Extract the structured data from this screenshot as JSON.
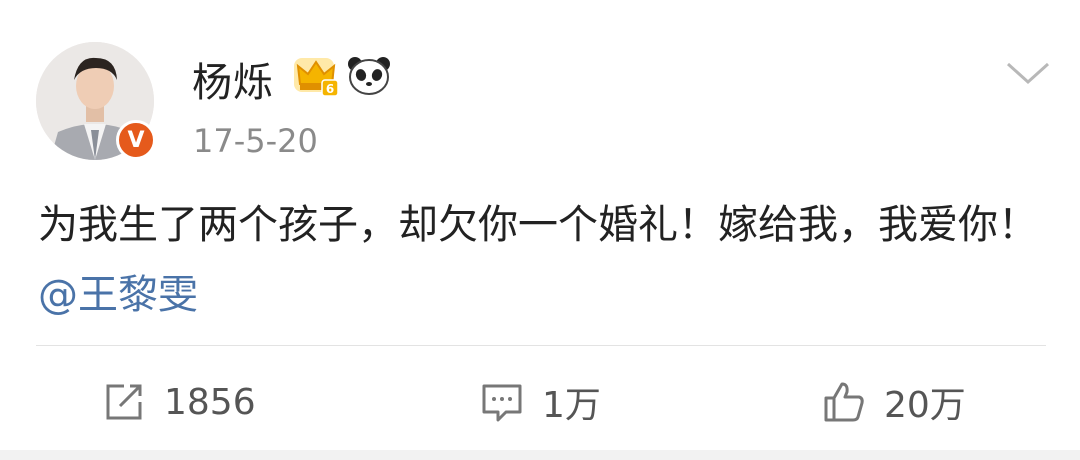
{
  "post": {
    "username": "杨烁",
    "timestamp": "17-5-20",
    "verified_mark": "V",
    "crown_level": "6",
    "icons": {
      "crown": "vip-crown-icon",
      "panda": "panda-icon",
      "chevron": "chevron-down-icon"
    },
    "content": {
      "text": "为我生了两个孩子，却欠你一个婚礼！嫁给我，我爱你！",
      "mention": "@王黎雯"
    },
    "actions": {
      "repost": {
        "icon": "repost-icon",
        "count": "1856"
      },
      "comment": {
        "icon": "comment-icon",
        "count": "1万"
      },
      "like": {
        "icon": "like-icon",
        "count": "20万"
      }
    },
    "colors": {
      "mention": "#4a73a8",
      "verified": "#e55a1c",
      "crown": "#f5b400"
    }
  }
}
